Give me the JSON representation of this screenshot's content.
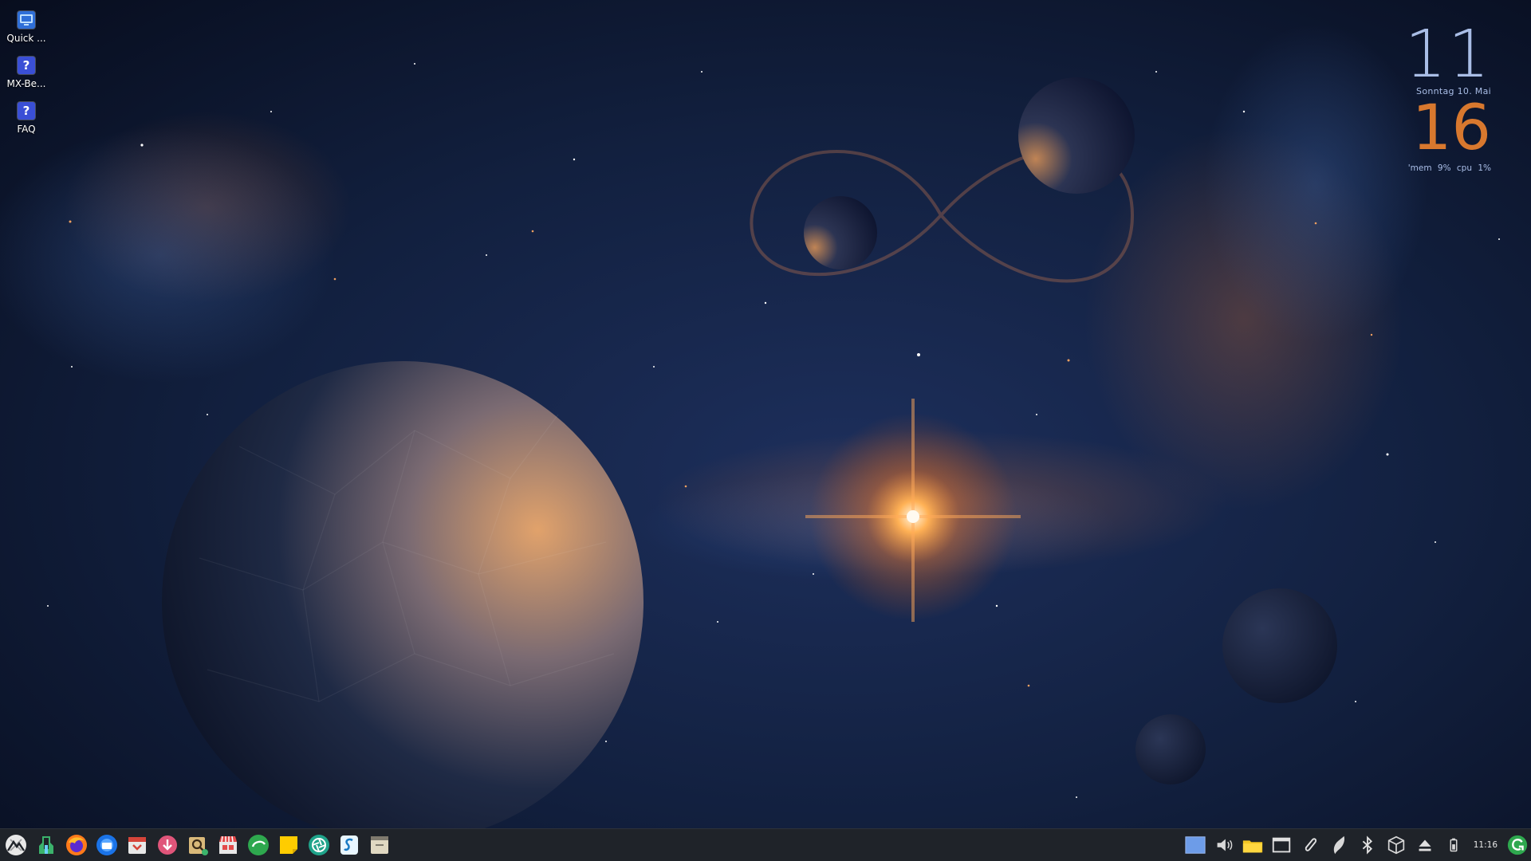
{
  "desktop": {
    "icons": [
      {
        "label": "Quick ...",
        "icon": "monitor-icon"
      },
      {
        "label": "MX-Be...",
        "icon": "help-icon"
      },
      {
        "label": "FAQ",
        "icon": "help-icon"
      }
    ]
  },
  "conky": {
    "hour": "11",
    "date": "Sonntag  10. Mai",
    "minute": "16",
    "stats": "'mem 9% cpu 1%"
  },
  "panel": {
    "launchers": [
      "mx-menu-icon",
      "mx-tools-icon",
      "firefox-icon",
      "thunderbird-icon",
      "mx-package-installer-icon",
      "downloader-icon",
      "search-files-icon",
      "app-store-icon",
      "update-icon",
      "sticky-notes-icon",
      "aperture-icon",
      "conky-manager-icon",
      "file-manager-icon"
    ],
    "tray": [
      "workspace-pager-icon",
      "volume-icon",
      "folder-icon",
      "window-icon",
      "clipboard-icon",
      "flameshot-icon",
      "bluetooth-icon",
      "package-box-icon",
      "eject-icon",
      "battery-icon"
    ],
    "clock": "11:16",
    "updater": "update-notifier-icon"
  },
  "colors": {
    "panel_bg": "#1f2329",
    "clock_blue": "#a9bde6",
    "clock_orange": "#d8782e"
  }
}
